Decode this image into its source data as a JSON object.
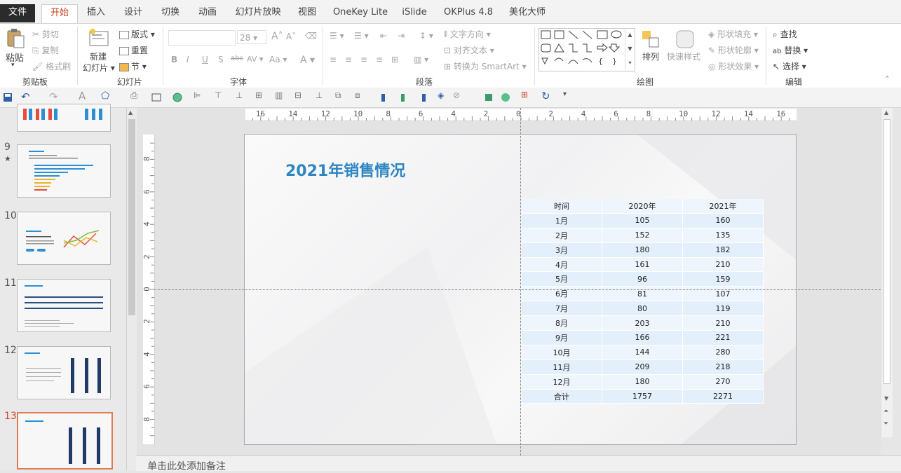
{
  "tabs": [
    "文件",
    "开始",
    "插入",
    "设计",
    "切换",
    "动画",
    "幻灯片放映",
    "视图",
    "OneKey Lite",
    "iSlide",
    "OKPlus 4.8",
    "美化大师"
  ],
  "clipboard": {
    "paste": "粘贴",
    "cut": "剪切",
    "copy": "复制",
    "format_painter": "格式刷",
    "label": "剪贴板"
  },
  "slides_group": {
    "new_slide": "新建",
    "new_slide_2": "幻灯片",
    "layout": "版式",
    "reset": "重置",
    "section": "节",
    "label": "幻灯片"
  },
  "font_group": {
    "font_size": "28",
    "label": "字体",
    "bold": "B",
    "italic": "I",
    "underline": "U",
    "shadow": "S",
    "strike": "abc",
    "spacing": "AV",
    "case": "Aa",
    "color": "A",
    "grow": "A",
    "shrink": "A"
  },
  "paragraph_group": {
    "text_direction": "文字方向",
    "align_text": "对齐文本",
    "convert_smartart": "转换为 SmartArt",
    "label": "段落"
  },
  "drawing_group": {
    "arrange": "排列",
    "quick_styles": "快速样式",
    "shape_fill": "形状填充",
    "shape_outline": "形状轮廓",
    "shape_effects": "形状效果",
    "label": "绘图"
  },
  "editing_group": {
    "find": "查找",
    "replace": "替换",
    "select": "选择",
    "label": "编辑"
  },
  "slide_numbers": [
    "9",
    "10",
    "11",
    "12",
    "13"
  ],
  "star": "★",
  "ruler_h": [
    "16",
    "14",
    "12",
    "10",
    "8",
    "6",
    "4",
    "2",
    "0",
    "2",
    "4",
    "6",
    "8",
    "10",
    "12",
    "14",
    "16"
  ],
  "ruler_v": [
    "8",
    "6",
    "4",
    "2",
    "0",
    "2",
    "4",
    "6",
    "8"
  ],
  "slide": {
    "title": "2021年销售情况",
    "table": {
      "headers": [
        "时间",
        "2020年",
        "2021年"
      ],
      "rows": [
        [
          "1月",
          "105",
          "160"
        ],
        [
          "2月",
          "152",
          "135"
        ],
        [
          "3月",
          "180",
          "182"
        ],
        [
          "4月",
          "161",
          "210"
        ],
        [
          "5月",
          "96",
          "159"
        ],
        [
          "6月",
          "81",
          "107"
        ],
        [
          "7月",
          "80",
          "119"
        ],
        [
          "8月",
          "203",
          "210"
        ],
        [
          "9月",
          "166",
          "221"
        ],
        [
          "10月",
          "144",
          "280"
        ],
        [
          "11月",
          "209",
          "218"
        ],
        [
          "12月",
          "180",
          "270"
        ],
        [
          "合计",
          "1757",
          "2271"
        ]
      ]
    }
  },
  "notes_placeholder": "单击此处添加备注",
  "colors": {
    "accent": "#c43e1c",
    "title": "#2d86c1",
    "table_cell": "#e3effa",
    "selected_thumb": "#e07a55"
  }
}
